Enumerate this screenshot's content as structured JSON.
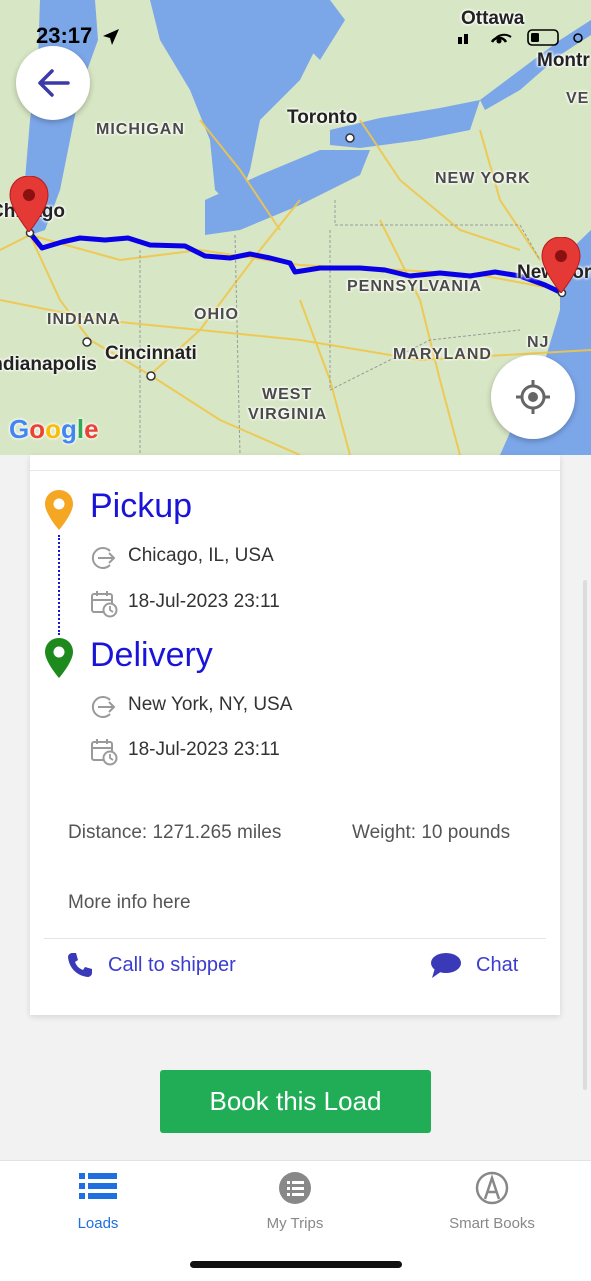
{
  "status_bar": {
    "time": "23:17"
  },
  "map": {
    "labels": {
      "ottawa": "Ottawa",
      "montreal": "Montr",
      "ve": "VE",
      "michigan": "MICHIGAN",
      "toronto": "Toronto",
      "new_york_state": "NEW YORK",
      "chicago": "Chicago",
      "new_york_city": "New York",
      "pennsylvania": "PENNSYLVANIA",
      "indiana": "INDIANA",
      "ohio": "OHIO",
      "indianapolis": "Indianapolis",
      "cincinnati": "Cincinnati",
      "maryland": "MARYLAND",
      "nj": "NJ",
      "west_virginia_1": "WEST",
      "west_virginia_2": "VIRGINIA"
    },
    "google_logo": "Google",
    "route_color": "#0a00e6",
    "marker_color": "#e53935"
  },
  "trip": {
    "pickup": {
      "title": "Pickup",
      "location": "Chicago, IL, USA",
      "datetime": "18-Jul-2023 23:11",
      "pin_color": "#f5a623"
    },
    "delivery": {
      "title": "Delivery",
      "location": "New York, NY, USA",
      "datetime": "18-Jul-2023 23:11",
      "pin_color": "#1e8a1e"
    },
    "distance": "Distance: 1271.265 miles",
    "weight": "Weight: 10 pounds",
    "more_info": "More info here",
    "call_label": "Call to shipper",
    "chat_label": "Chat"
  },
  "book_button": "Book this Load",
  "tabs": [
    {
      "label": "Loads",
      "icon": "list-icon",
      "active": true
    },
    {
      "label": "My Trips",
      "icon": "list-circle-icon",
      "active": false
    },
    {
      "label": "Smart Books",
      "icon": "smart-books-icon",
      "active": false
    }
  ],
  "colors": {
    "accent": "#1a14d8",
    "tab_active": "#1f6fe0",
    "book_green": "#21ad55"
  }
}
